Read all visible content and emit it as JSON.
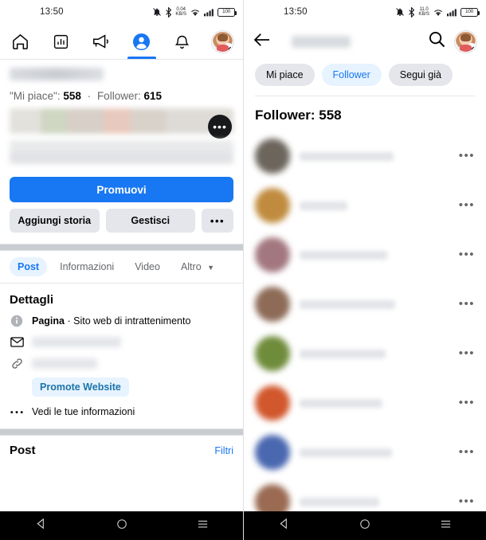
{
  "left": {
    "statusbar": {
      "time": "13:50",
      "battery_level": "100",
      "netspeed_value": "0.04",
      "netspeed_unit": "KB/S",
      "icons": [
        "bell-muted-icon",
        "bluetooth-icon",
        "network-speed-icon",
        "wifi-icon",
        "cellular-signal-icon",
        "battery-icon"
      ]
    },
    "topnav": [
      {
        "name": "home-icon",
        "label": "Home",
        "active": false
      },
      {
        "name": "insights-icon",
        "label": "Insights",
        "active": false
      },
      {
        "name": "megaphone-icon",
        "label": "Ads",
        "active": false
      },
      {
        "name": "profile-icon",
        "label": "Profilo",
        "active": true
      },
      {
        "name": "bell-icon",
        "label": "Notifiche",
        "active": false
      },
      {
        "name": "account-avatar-icon",
        "label": "Account",
        "active": false
      }
    ],
    "profile": {
      "page_name_hidden": true,
      "stats_likes_label": "\"Mi piace\":",
      "stats_likes_value": "558",
      "stats_separator": "·",
      "stats_followers_label": "Follower:",
      "stats_followers_value": "615",
      "cover_more_button": "•••",
      "promote_button": "Promuovi",
      "add_story_button": "Aggiungi storia",
      "manage_button": "Gestisci",
      "more_button": "•••"
    },
    "subtabs": [
      {
        "label": "Post",
        "active": true,
        "caret": false
      },
      {
        "label": "Informazioni",
        "active": false,
        "caret": false
      },
      {
        "label": "Video",
        "active": false,
        "caret": false
      },
      {
        "label": "Altro",
        "active": false,
        "caret": true
      }
    ],
    "details": {
      "heading": "Dettagli",
      "category_bold": "Pagina",
      "category_separator": " · ",
      "category_rest": "Sito web di intrattenimento",
      "email_hidden": true,
      "website_hidden": true,
      "promote_website_button": "Promote Website",
      "see_your_info": "Vedi le tue informazioni"
    },
    "posts_section": {
      "title": "Post",
      "filter_label": "Filtri"
    }
  },
  "right": {
    "statusbar": {
      "time": "13:50",
      "battery_level": "100",
      "netspeed_value": "11.0",
      "netspeed_unit": "KB/S"
    },
    "header": {
      "back_icon": "arrow-left-icon",
      "title_hidden": true,
      "search_icon": "search-icon",
      "account_icon": "account-avatar-icon"
    },
    "chips": [
      {
        "label": "Mi piace",
        "active": false
      },
      {
        "label": "Follower",
        "active": true
      },
      {
        "label": "Segui già",
        "active": false
      }
    ],
    "count_heading": "Follower: 558",
    "rows": [
      {
        "avatar_color": "#6b655c",
        "name_width": 118,
        "more": "•••"
      },
      {
        "avatar_color": "#c08b3e",
        "name_width": 60,
        "more": "•••"
      },
      {
        "avatar_color": "#a3777f",
        "name_width": 110,
        "more": "•••"
      },
      {
        "avatar_color": "#8d6b57",
        "name_width": 120,
        "more": "•••"
      },
      {
        "avatar_color": "#6f8c3b",
        "name_width": 108,
        "more": "•••"
      },
      {
        "avatar_color": "#d1572c",
        "name_width": 104,
        "more": "•••"
      },
      {
        "avatar_color": "#4a68b0",
        "name_width": 116,
        "more": "•••"
      },
      {
        "avatar_color": "#9a6a52",
        "name_width": 100,
        "more": "•••"
      }
    ]
  },
  "android_nav": {
    "back": "back-triangle-icon",
    "home": "home-circle-icon",
    "recents": "recents-menu-icon"
  },
  "colors": {
    "accent_blue": "#1877f2",
    "chip_active_bg": "#e7f3ff",
    "button_gray": "#e4e6eb",
    "text_primary": "#050505",
    "text_secondary": "#65676b"
  }
}
